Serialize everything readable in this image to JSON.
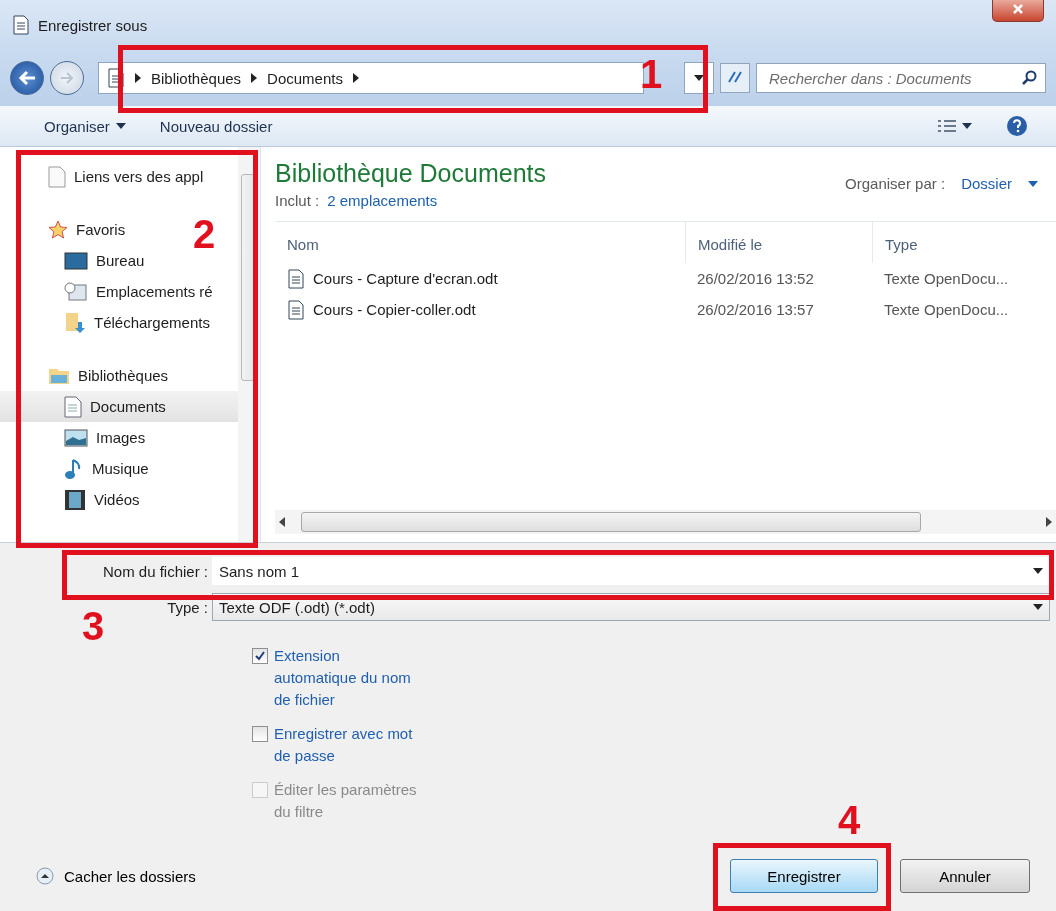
{
  "window": {
    "title": "Enregistrer sous"
  },
  "address_bar": {
    "crumbs": [
      "Bibliothèques",
      "Documents"
    ]
  },
  "search": {
    "placeholder": "Rechercher dans : Documents"
  },
  "toolbar": {
    "items": [
      "Organiser",
      "Nouveau dossier"
    ]
  },
  "sidebar": {
    "items": [
      {
        "kind": "link",
        "label": "Liens vers des appl",
        "selected": false
      },
      {
        "kind": "favorites",
        "label": "Favoris",
        "selected": false,
        "children": [
          {
            "kind": "desktop",
            "label": "Bureau",
            "selected": false
          },
          {
            "kind": "recent",
            "label": "Emplacements ré",
            "selected": false
          },
          {
            "kind": "downloads",
            "label": "Téléchargements",
            "selected": false
          }
        ]
      },
      {
        "kind": "libraries",
        "label": "Bibliothèques",
        "selected": false,
        "children": [
          {
            "kind": "documents",
            "label": "Documents",
            "selected": true
          },
          {
            "kind": "pictures",
            "label": "Images",
            "selected": false
          },
          {
            "kind": "music",
            "label": "Musique",
            "selected": false
          },
          {
            "kind": "videos",
            "label": "Vidéos",
            "selected": false
          }
        ]
      }
    ]
  },
  "library": {
    "title": "Bibliothèque Documents",
    "includes_label": "Inclut :",
    "includes_link": "2 emplacements",
    "arrange_label": "Organiser par :",
    "arrange_value": "Dossier"
  },
  "table": {
    "columns": [
      "Nom",
      "Modifié le",
      "Type"
    ],
    "rows": [
      [
        "Cours - Capture d'ecran.odt",
        "26/02/2016 13:52",
        "Texte OpenDocu..."
      ],
      [
        "Cours - Copier-coller.odt",
        "26/02/2016 13:57",
        "Texte OpenDocu..."
      ]
    ]
  },
  "form": {
    "filename_label": "Nom du fichier :",
    "filename": "Sans nom 1",
    "type_label": "Type :",
    "type_value": "Texte ODF (.odt) (*.odt)"
  },
  "options": [
    {
      "label": "Extension automatique du nom de fichier",
      "checked": true,
      "disabled": false
    },
    {
      "label": "Enregistrer avec mot de passe",
      "checked": false,
      "disabled": false
    },
    {
      "label": "Éditer les paramètres du filtre",
      "checked": false,
      "disabled": true
    }
  ],
  "hide_folders": "Cacher les dossiers",
  "buttons": [
    {
      "label": "Enregistrer",
      "default": true
    },
    {
      "label": "Annuler",
      "default": false
    }
  ],
  "annotations": [
    {
      "label": "1"
    },
    {
      "label": "2"
    },
    {
      "label": "3"
    },
    {
      "label": "4"
    }
  ]
}
